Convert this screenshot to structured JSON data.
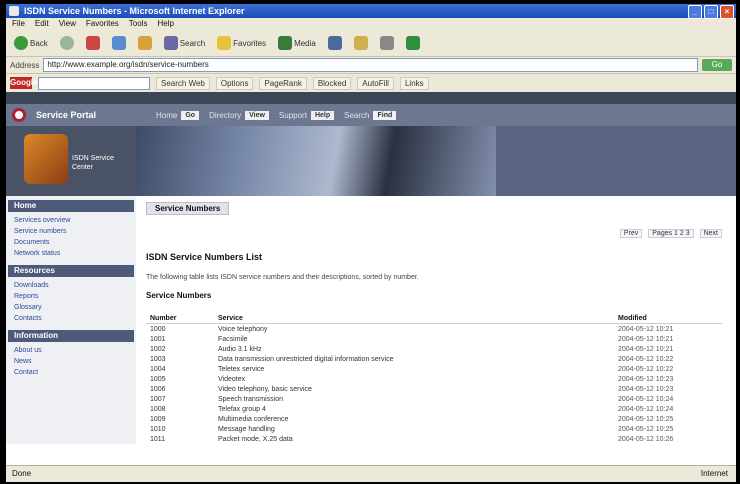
{
  "window": {
    "title": "ISDN Service Numbers - Microsoft Internet Explorer"
  },
  "menu": [
    "File",
    "Edit",
    "View",
    "Favorites",
    "Tools",
    "Help"
  ],
  "toolbar": {
    "back": "Back",
    "search": "Search",
    "favorites": "Favorites",
    "media": "Media"
  },
  "address": {
    "label": "Address",
    "url": "http://www.example.org/isdn/service-numbers",
    "go": "Go"
  },
  "links": {
    "google_logo": "Google",
    "chips": [
      "Search Web",
      "Options",
      "PageRank",
      "Blocked",
      "AutoFill",
      "Links"
    ]
  },
  "site": {
    "name": "Service Portal",
    "nav": [
      {
        "label": "Home",
        "tag": "Go"
      },
      {
        "label": "Directory",
        "tag": "View"
      },
      {
        "label": "Support",
        "tag": "Help"
      },
      {
        "label": "Search",
        "tag": "Find"
      }
    ],
    "banner_caption": "ISDN Service Center"
  },
  "sidebar": [
    {
      "title": "Home",
      "links": [
        "Services overview",
        "Service numbers",
        "Documents",
        "Network status"
      ]
    },
    {
      "title": "Resources",
      "links": [
        "Downloads",
        "Reports",
        "Glossary",
        "Contacts"
      ]
    },
    {
      "title": "Information",
      "links": [
        "About us",
        "News",
        "Contact"
      ]
    }
  ],
  "main": {
    "tab": "Service Numbers",
    "pager": {
      "prev": "Prev",
      "pages": "Pages 1 2 3",
      "next": "Next"
    },
    "title": "ISDN Service Numbers List",
    "description": "The following table lists ISDN service numbers and their descriptions, sorted by number.",
    "subhead": "Service Numbers",
    "columns": [
      "Number",
      "Service",
      "Modified"
    ],
    "rows": [
      [
        "1000",
        "Voice telephony",
        "2004-05-12 10:21"
      ],
      [
        "1001",
        "Facsimile",
        "2004-05-12 10:21"
      ],
      [
        "1002",
        "Audio 3.1 kHz",
        "2004-05-12 10:21"
      ],
      [
        "1003",
        "Data transmission unrestricted digital information service",
        "2004-05-12 10:22"
      ],
      [
        "1004",
        "Teletex service",
        "2004-05-12 10:22"
      ],
      [
        "1005",
        "Videotex",
        "2004-05-12 10:23"
      ],
      [
        "1006",
        "Video telephony, basic service",
        "2004-05-12 10:23"
      ],
      [
        "1007",
        "Speech transmission",
        "2004-05-12 10:24"
      ],
      [
        "1008",
        "Telefax group 4",
        "2004-05-12 10:24"
      ],
      [
        "1009",
        "Multimedia conference",
        "2004-05-12 10:25"
      ],
      [
        "1010",
        "Message handling",
        "2004-05-12 10:25"
      ],
      [
        "1011",
        "Packet mode, X.25 data",
        "2004-05-12 10:26"
      ]
    ]
  },
  "status": {
    "left": "Done",
    "right": "Internet"
  }
}
